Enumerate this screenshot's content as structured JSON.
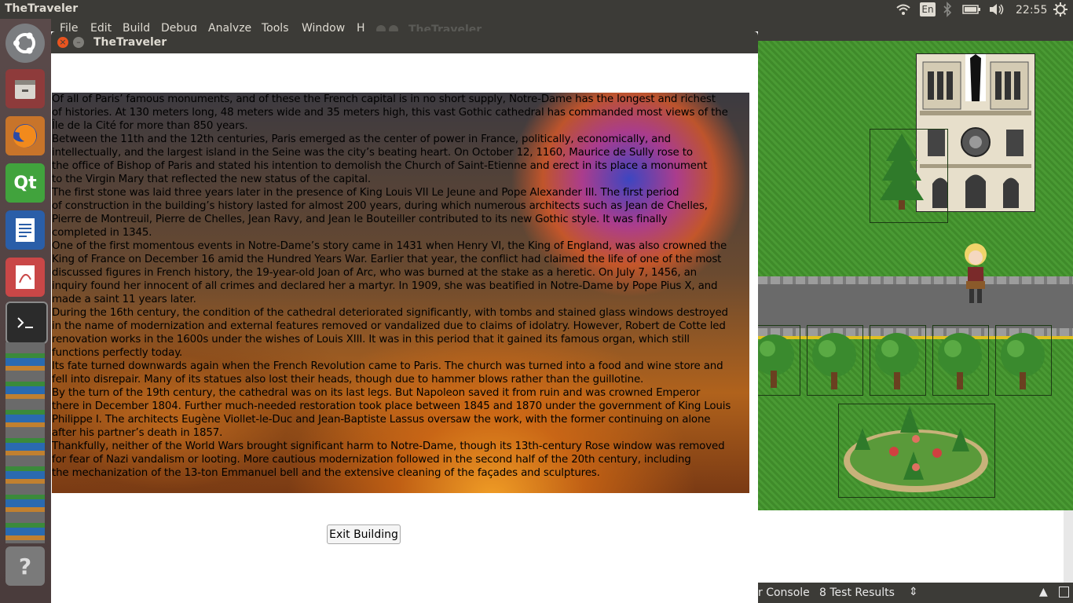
{
  "top_panel": {
    "app_name": "TheTraveler",
    "keyboard_layout": "En",
    "clock": "22:55",
    "icons": [
      "wifi-icon",
      "bluetooth-icon",
      "battery-icon",
      "volume-icon",
      "gear-icon"
    ]
  },
  "ide": {
    "menu": [
      "File",
      "Edit",
      "Build",
      "Debug",
      "Analyze",
      "Tools",
      "Window",
      "H"
    ],
    "ghost_title": "TheTraveler",
    "status_tabs": [
      "r Console",
      "8  Test Results"
    ]
  },
  "launcher": {
    "items": [
      "ubuntu-icon",
      "files-icon",
      "firefox-icon",
      "qt-creator-icon",
      "writer-icon",
      "document-viewer-icon",
      "terminal-icon",
      "help-icon"
    ],
    "qt_label": "Qt"
  },
  "dialog": {
    "title": "TheTraveler",
    "close_glyph": "×",
    "min_glyph": "–",
    "history_text": "Of all of Paris’ famous monuments, and of these the French capital is in no short supply, Notre-Dame has the longest and richest\nof histories. At 130 meters long, 48 meters wide and 35 meters high, this vast Gothic cathedral has commanded most views of the\nÎle de la Cité for more than 850 years.\nBetween the 11th and the 12th centuries, Paris emerged as the center of power in France, politically, economically, and\nintellectually, and the largest island in the Seine was the city’s beating heart. On October 12, 1160, Maurice de Sully rose to\nthe office of Bishop of Paris and stated his intention to demolish the Church of Saint-Etienne and erect in its place a monument\nto the Virgin Mary that reflected the new status of the capital.\nThe first stone was laid three years later in the presence of King Louis VII Le Jeune and Pope Alexander III. The first period\nof construction in the building’s history lasted for almost 200 years, during which numerous architects such as Jean de Chelles,\nPierre de Montreuil, Pierre de Chelles, Jean Ravy, and Jean le Bouteiller contributed to its new Gothic style. It was finally\ncompleted in 1345.\nOne of the first momentous events in Notre-Dame’s story came in 1431 when Henry VI, the King of England, was also crowned the\nKing of France on December 16 amid the Hundred Years War. Earlier that year, the conflict had claimed the life of one of the most\ndiscussed figures in French history, the 19-year-old Joan of Arc, who was burned at the stake as a heretic. On July 7, 1456, an\ninquiry found her innocent of all crimes and declared her a martyr. In 1909, she was beatified in Notre-Dame by Pope Pius X, and\nmade a saint 11 years later.\nDuring the 16th century, the condition of the cathedral deteriorated significantly, with tombs and stained glass windows destroyed\nin the name of modernization and external features removed or vandalized due to claims of idolatry. However, Robert de Cotte led\nrenovation works in the 1600s under the wishes of Louis XIII. It was in this period that it gained its famous organ, which still\nfunctions perfectly today.\nIts fate turned downwards again when the French Revolution came to Paris. The church was turned into a food and wine store and\nfell into disrepair. Many of its statues also lost their heads, though due to hammer blows rather than the guillotine.\nBy the turn of the 19th century, the cathedral was on its last legs. But Napoleon saved it from ruin and was crowned Emperor\nthere in December 1804. Further much-needed restoration took place between 1845 and 1870 under the government of King Louis\nPhilippe I. The architects Eugène Viollet-le-Duc and Jean-Baptiste Lassus oversaw the work, with the former continuing on alone\nafter his partner’s death in 1857.\nThankfully, neither of the World Wars brought significant harm to Notre-Dame, though its 13th-century Rose window was removed\nfor fear of Nazi vandalism or looting. More cautious modernization followed in the second half of the 20th century, including\nthe mechanization of the 13-ton Emmanuel bell and the extensive cleaning of the façades and sculptures.",
    "exit_button": "Exit Building"
  },
  "colors": {
    "panel": "#3c3b37",
    "close": "#e9541f",
    "grass": "#3f8b2a",
    "road": "#5a5a5a"
  }
}
